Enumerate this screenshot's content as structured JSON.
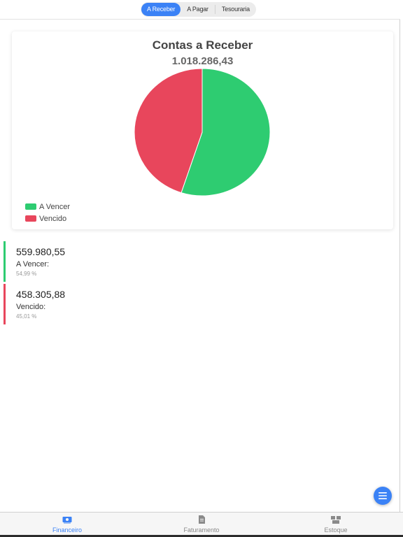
{
  "tabs": [
    {
      "label": "A Receber",
      "active": true
    },
    {
      "label": "A Pagar",
      "active": false
    },
    {
      "label": "Tesouraria",
      "active": false
    }
  ],
  "card": {
    "title": "Contas a Receber",
    "total": "1.018.286,43"
  },
  "chart_data": {
    "type": "pie",
    "title": "Contas a Receber",
    "subtitle": "1.018.286,43",
    "categories": [
      "A Vencer",
      "Vencido"
    ],
    "values": [
      559980.55,
      458305.88
    ],
    "percentages": [
      54.99,
      45.01
    ],
    "colors": [
      "#2ecc71",
      "#e8465c"
    ],
    "legend": "bottom-left"
  },
  "legend": [
    {
      "label": "A Vencer",
      "color": "#2ecc71"
    },
    {
      "label": "Vencido",
      "color": "#e8465c"
    }
  ],
  "summary": [
    {
      "amount": "559.980,55",
      "label": "A Vencer:",
      "percent": "54,99 %",
      "color": "#2ecc71"
    },
    {
      "amount": "458.305,88",
      "label": "Vencido:",
      "percent": "45,01 %",
      "color": "#e8465c"
    }
  ],
  "fab": {
    "icon": "menu-icon",
    "color": "#3b82f6"
  },
  "nav": [
    {
      "label": "Financeiro",
      "icon": "money-icon",
      "active": true
    },
    {
      "label": "Faturamento",
      "icon": "document-icon",
      "active": false
    },
    {
      "label": "Estoque",
      "icon": "boxes-icon",
      "active": false
    }
  ],
  "colors": {
    "accent": "#3b82f6",
    "positive": "#2ecc71",
    "negative": "#e8465c"
  }
}
